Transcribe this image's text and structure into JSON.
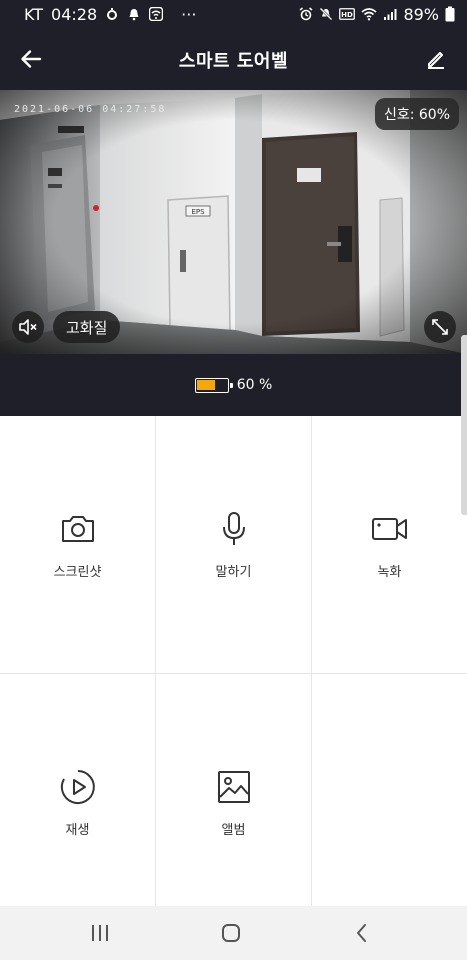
{
  "status_bar": {
    "carrier": "KT",
    "time": "04:28",
    "more": "···",
    "battery_percent": "89%",
    "left_icons": [
      "usb-icon",
      "notification-bell-icon",
      "wifi-box-icon"
    ],
    "right_icons": [
      "alarm-icon",
      "mute-icon",
      "hd-icon",
      "wifi-icon",
      "cell-signal-icon",
      "battery-icon"
    ]
  },
  "header": {
    "title": "스마트 도어벨",
    "back_icon": "arrow-left-icon",
    "edit_icon": "pencil-icon"
  },
  "camera": {
    "timestamp": "2021-06-06 04:27:58",
    "signal_label": "신호: 60%",
    "quality_label": "고화질",
    "mute_icon": "speaker-mute-icon",
    "fullscreen_icon": "expand-icon",
    "sign_text": "EPS"
  },
  "battery": {
    "level": 0.6,
    "label": "60 %",
    "fill_color": "#f5a80a"
  },
  "actions": [
    {
      "label": "스크린샷",
      "icon": "camera-icon"
    },
    {
      "label": "말하기",
      "icon": "microphone-icon"
    },
    {
      "label": "녹화",
      "icon": "video-camera-icon"
    },
    {
      "label": "재생",
      "icon": "play-circle-icon"
    },
    {
      "label": "앨범",
      "icon": "image-icon"
    }
  ],
  "nav": {
    "recent_icon": "recent-apps-icon",
    "home_icon": "home-icon",
    "back_icon": "nav-back-icon"
  },
  "colors": {
    "header_bg": "#1e1f29",
    "nav_bg": "#f2f2f2"
  }
}
